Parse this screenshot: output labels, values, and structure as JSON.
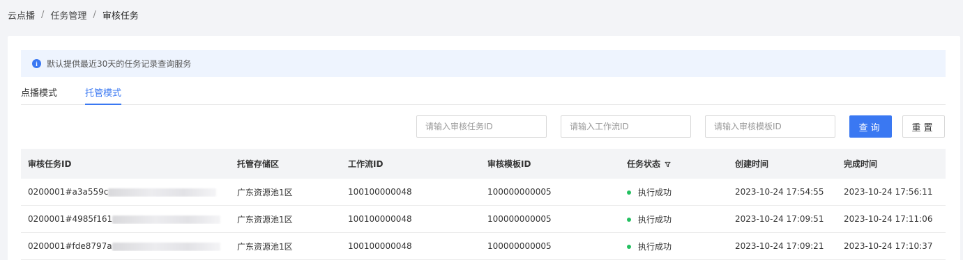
{
  "breadcrumb": {
    "items": [
      "云点播",
      "任务管理",
      "审核任务"
    ],
    "separator": "/"
  },
  "notice": {
    "text": "默认提供最近30天的任务记录查询服务"
  },
  "tabs": [
    {
      "label": "点播模式",
      "active": false
    },
    {
      "label": "托管模式",
      "active": true
    }
  ],
  "filters": {
    "task_id_placeholder": "请输入审核任务ID",
    "workflow_id_placeholder": "请输入工作流ID",
    "template_id_placeholder": "请输入审核模板ID",
    "query_label": "查询",
    "reset_label": "重置"
  },
  "table": {
    "columns": [
      "审核任务ID",
      "托管存储区",
      "工作流ID",
      "审核模板ID",
      "任务状态",
      "创建时间",
      "完成时间"
    ],
    "rows": [
      {
        "task_id": "0200001#a3a559c",
        "storage": "广东资源池1区",
        "workflow_id": "100100000048",
        "template_id": "100000000005",
        "status": "执行成功",
        "created": "2023-10-24 17:54:55",
        "finished": "2023-10-24 17:56:11"
      },
      {
        "task_id": "0200001#4985f161",
        "storage": "广东资源池1区",
        "workflow_id": "100100000048",
        "template_id": "100000000005",
        "status": "执行成功",
        "created": "2023-10-24 17:09:51",
        "finished": "2023-10-24 17:11:06"
      },
      {
        "task_id": "0200001#fde8797a",
        "storage": "广东资源池1区",
        "workflow_id": "100100000048",
        "template_id": "100000000005",
        "status": "执行成功",
        "created": "2023-10-24 17:09:21",
        "finished": "2023-10-24 17:10:37"
      }
    ]
  },
  "colors": {
    "primary": "#3a78f2",
    "success": "#23c060",
    "notice_bg": "#eef4fe"
  },
  "icons": {
    "notice": "info-icon",
    "status_filter": "filter-icon",
    "status": "status-dot"
  }
}
